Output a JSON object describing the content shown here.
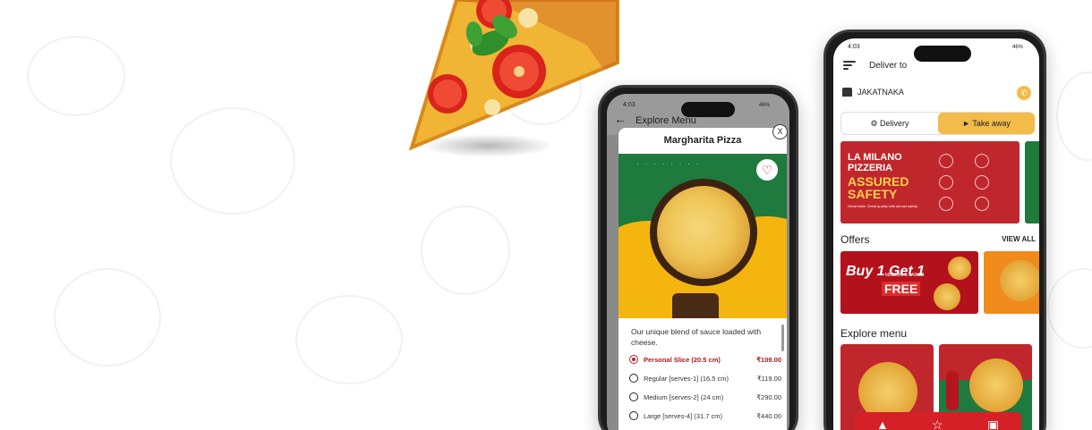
{
  "colors": {
    "brand_red": "#c0272d",
    "brand_green": "#1e7a3d",
    "accent_yellow": "#f2bb4a"
  },
  "item_sheet": {
    "status_time": "4:03",
    "status_right": "46%",
    "behind_title": "Explore Menu",
    "close_label": "X",
    "title": "Margharita Pizza",
    "description": "Our unique blend of sauce loaded with cheese.",
    "options": [
      {
        "label": "Personal Slice (20.5 cm)",
        "price": "₹109.00",
        "selected": true
      },
      {
        "label": "Regular [serves-1] (16.5 cm)",
        "price": "₹119.00",
        "selected": false
      },
      {
        "label": "Medium [serves-2] (24 cm)",
        "price": "₹290.00",
        "selected": false
      },
      {
        "label": "Large [serves-4] (31.7 cm)",
        "price": "₹440.00",
        "selected": false
      }
    ],
    "icons": [
      "back-arrow-icon",
      "close-icon",
      "heart-icon"
    ]
  },
  "home": {
    "status_time": "4:03",
    "status_right": "46%",
    "deliver_to": "Deliver to",
    "location": "JAKATNAKA",
    "tabs": {
      "delivery": "Delivery",
      "takeaway": "Take away"
    },
    "banner": {
      "line1": "LA MILANO",
      "line2": "PIZZERIA",
      "line3": "ASSURED",
      "line4": "SAFETY",
      "small": "Great taste. Great quality with utmost safety."
    },
    "offers_title": "Offers",
    "view_all": "VIEW ALL",
    "offer": {
      "bogo": "Buy 1 Get 1",
      "sub": "MEDIUM & LARGE",
      "free": "FREE"
    },
    "explore_title": "Explore menu",
    "icons": [
      "menu-icon",
      "store-icon",
      "phone-icon",
      "delivery-icon",
      "takeaway-icon",
      "pizza-icon",
      "star-icon",
      "cart-icon"
    ]
  }
}
